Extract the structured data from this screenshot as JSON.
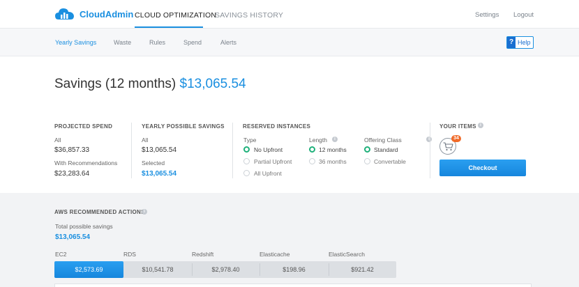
{
  "brand": {
    "name": "CloudAdmin",
    "color": "#1a8fe0"
  },
  "top_nav": {
    "tabs": [
      {
        "label": "CLOUD OPTIMIZATION",
        "active": true
      },
      {
        "label": "SAVINGS HISTORY",
        "active": false
      }
    ],
    "settings": "Settings",
    "logout": "Logout"
  },
  "sub_nav": {
    "tabs": [
      {
        "label": "Yearly Savings",
        "active": true
      },
      {
        "label": "Waste",
        "active": false
      },
      {
        "label": "Rules",
        "active": false
      },
      {
        "label": "Spend",
        "active": false
      },
      {
        "label": "Alerts",
        "active": false
      }
    ],
    "help": {
      "icon": "?",
      "label": "Help"
    }
  },
  "savings": {
    "label": "Savings (12 months)",
    "amount": "$13,065.54"
  },
  "projected_spend": {
    "heading": "PROJECTED SPEND",
    "all_label": "All",
    "all_value": "$36,857.33",
    "with_rec_label": "With Recommendations",
    "with_rec_value": "$23,283.64"
  },
  "yearly_possible": {
    "heading": "YEARLY POSSIBLE SAVINGS",
    "all_label": "All",
    "all_value": "$13,065.54",
    "selected_label": "Selected",
    "selected_value": "$13,065.54"
  },
  "reserved": {
    "heading": "RESERVED INSTANCES",
    "type": {
      "label": "Type",
      "options": [
        {
          "label": "No Upfront",
          "selected": true
        },
        {
          "label": "Partial Upfront",
          "selected": false
        },
        {
          "label": "All Upfront",
          "selected": false
        }
      ]
    },
    "length": {
      "label": "Length",
      "options": [
        {
          "label": "12 months",
          "selected": true
        },
        {
          "label": "36 months",
          "selected": false
        }
      ]
    },
    "offering": {
      "label": "Offering Class",
      "options": [
        {
          "label": "Standard",
          "selected": true
        },
        {
          "label": "Convertable",
          "selected": false
        }
      ]
    }
  },
  "your_items": {
    "heading": "YOUR ITEMS",
    "count": "34",
    "checkout": "Checkout",
    "badge_color": "#f06a28"
  },
  "aws": {
    "heading": "AWS RECOMMENDED ACTIONS",
    "total_label": "Total possible savings",
    "total_value": "$13,065.54",
    "services": [
      {
        "name": "EC2",
        "value": "$2,573.69",
        "active": true
      },
      {
        "name": "RDS",
        "value": "$10,541.78",
        "active": false
      },
      {
        "name": "Redshift",
        "value": "$2,978.40",
        "active": false
      },
      {
        "name": "Elasticache",
        "value": "$198.96",
        "active": false
      },
      {
        "name": "ElasticSearch",
        "value": "$921.42",
        "active": false
      }
    ]
  }
}
